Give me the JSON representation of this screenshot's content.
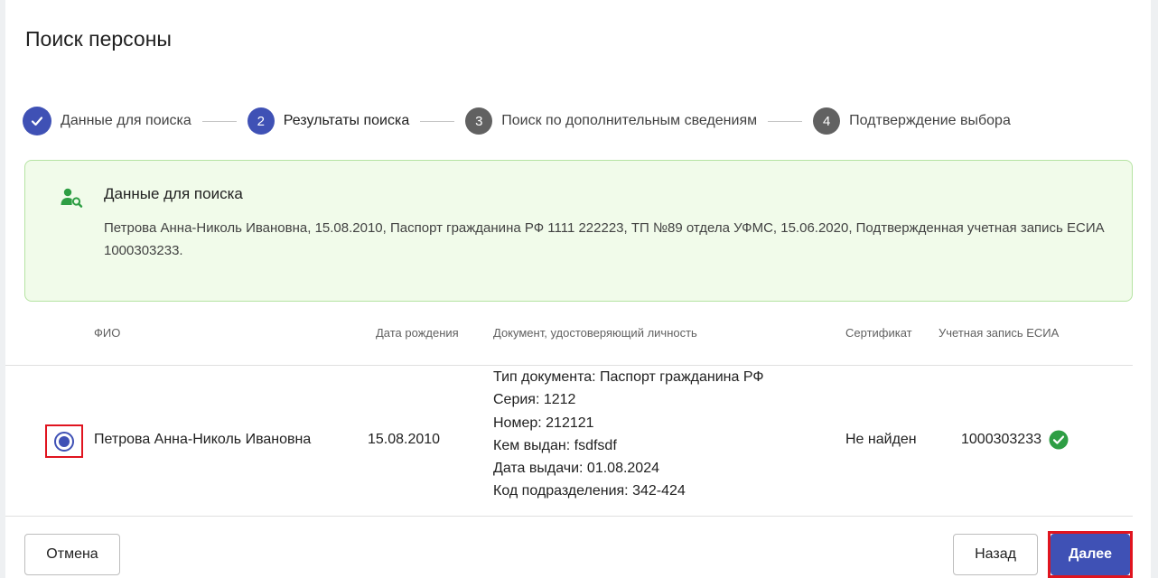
{
  "dialog": {
    "title": "Поиск персоны"
  },
  "stepper": {
    "steps": [
      {
        "number": "",
        "label": "Данные для поиска",
        "state": "done"
      },
      {
        "number": "2",
        "label": "Результаты поиска",
        "state": "active"
      },
      {
        "number": "3",
        "label": "Поиск по дополнительным сведениям",
        "state": "todo"
      },
      {
        "number": "4",
        "label": "Подтверждение выбора",
        "state": "todo"
      }
    ]
  },
  "search_info": {
    "title": "Данные для поиска",
    "text": "Петрова Анна-Николь Ивановна, 15.08.2010, Паспорт гражданина РФ 1111 222223, ТП №89 отдела УФМС, 15.06.2020, Подтвержденная учетная запись ЕСИА 1000303233."
  },
  "table": {
    "headers": {
      "fio": "ФИО",
      "birth_date": "Дата рождения",
      "document": "Документ, удостоверяющий личность",
      "certificate": "Сертификат",
      "esia": "Учетная запись ЕСИА"
    },
    "rows": [
      {
        "selected": true,
        "fio": "Петрова Анна-Николь Ивановна",
        "birth_date": "15.08.2010",
        "document_lines": [
          "Тип документа: Паспорт гражданина РФ",
          "Серия: 1212",
          "Номер: 212121",
          "Кем выдан: fsdfsdf",
          "Дата выдачи: 01.08.2024",
          "Код подразделения: 342-424"
        ],
        "certificate": "Не найден",
        "esia": "1000303233",
        "esia_status_icon": "check-circle-icon"
      }
    ]
  },
  "actions": {
    "cancel_label": "Отмена",
    "back_label": "Назад",
    "next_label": "Далее"
  },
  "colors": {
    "primary": "#3f51b5",
    "success": "#2e9e44",
    "info_bg": "#f1fbea",
    "info_border": "#b5e3a2",
    "highlight": "#e0141f"
  }
}
